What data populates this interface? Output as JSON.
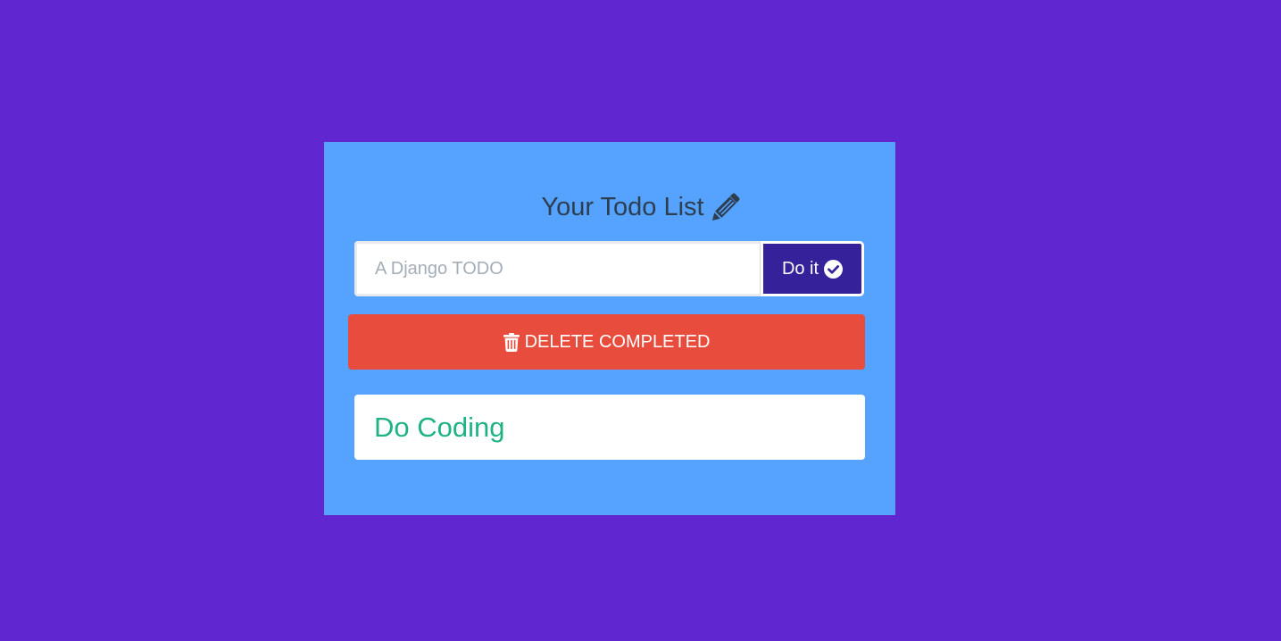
{
  "colors": {
    "page_background": "#6027d0",
    "card_background": "#55a2ff",
    "title_text": "#2c3e50",
    "submit_button": "#35219a",
    "delete_button": "#e74c3c",
    "todo_text": "#1fb384"
  },
  "header": {
    "title": "Your Todo List",
    "icon": "pencil-icon"
  },
  "form": {
    "input_value": "",
    "input_placeholder": "A Django TODO",
    "submit_label": "Do it",
    "submit_icon": "check-circle-icon"
  },
  "actions": {
    "delete_label": "DELETE COMPLETED",
    "delete_icon": "trash-icon"
  },
  "todos": [
    {
      "text": "Do Coding"
    }
  ]
}
